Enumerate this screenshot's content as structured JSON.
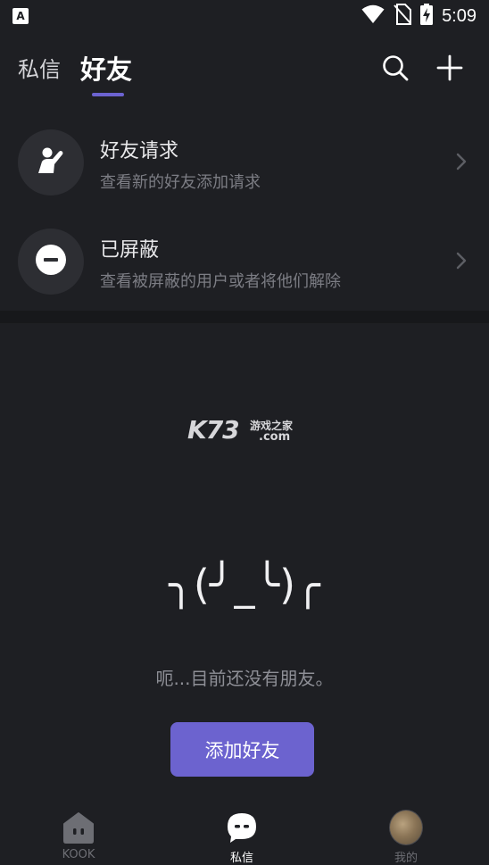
{
  "status_bar": {
    "time": "5:09",
    "app_icon_letter": "A"
  },
  "header": {
    "tab_dm": "私信",
    "tab_friends": "好友",
    "accent_color": "#6c63d1"
  },
  "rows": [
    {
      "title": "好友请求",
      "subtitle": "查看新的好友添加请求",
      "icon": "friend-request-icon"
    },
    {
      "title": "已屏蔽",
      "subtitle": "查看被屏蔽的用户或者将他们解除",
      "icon": "block-icon"
    }
  ],
  "watermark": {
    "main": "K73",
    "side": "游戏之家",
    "dotcom": ".com"
  },
  "empty_state": {
    "kaomoji": "╮(╯_╰)╭",
    "message": "呃...目前还没有朋友。",
    "button_label": "添加好友"
  },
  "bottom_nav": {
    "items": [
      {
        "label": "KOOK",
        "icon": "home-icon",
        "active": false
      },
      {
        "label": "私信",
        "icon": "chat-bubble-icon",
        "active": true
      },
      {
        "label": "我的",
        "icon": "avatar",
        "active": false
      }
    ]
  }
}
